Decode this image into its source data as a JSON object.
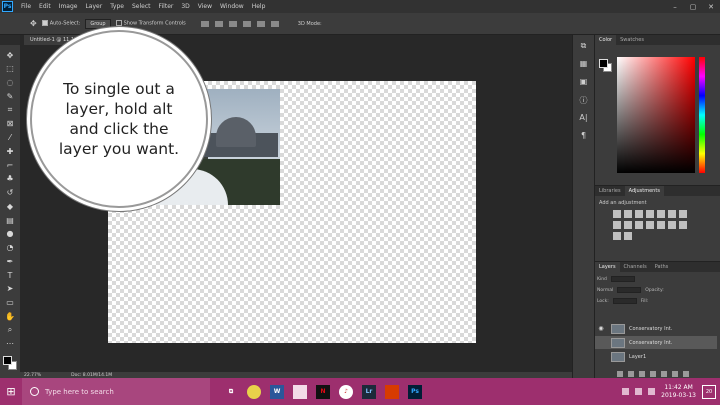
{
  "app": {
    "logo": "Ps",
    "menu": [
      "File",
      "Edit",
      "Image",
      "Layer",
      "Type",
      "Select",
      "Filter",
      "3D",
      "View",
      "Window",
      "Help"
    ],
    "window_controls": [
      "–",
      "▢",
      "✕"
    ]
  },
  "options_bar": {
    "auto_select_label": "Auto-Select:",
    "auto_select_value": "Group",
    "transform_label": "Show Transform Controls",
    "mode_label": "3D Mode:"
  },
  "document": {
    "tab_label": "Untitled-1 @ 11.1% (Conservatory Int..., RGB/8) *"
  },
  "callout": {
    "text": "To single out a layer, hold alt and click the layer you want."
  },
  "status_bar": {
    "zoom": "22.77%",
    "doc_size": "Doc: 8.01M/14.1M"
  },
  "panels": {
    "color_tabs": [
      "Color",
      "Swatches"
    ],
    "adjust_tabs": [
      "Libraries",
      "Adjustments"
    ],
    "adjust_label": "Add an adjustment",
    "layers_tabs": [
      "Layers",
      "Channels",
      "Paths"
    ],
    "layers_kind": "Kind",
    "blend_mode": "Normal",
    "opacity_label": "Opacity:",
    "lock_label": "Lock:",
    "fill_label": "Fill:",
    "layers": [
      {
        "name": "Conservatory Int.",
        "visible": true,
        "selected": false
      },
      {
        "name": "Conservatory Int.",
        "visible": false,
        "selected": true
      },
      {
        "name": "Layer1",
        "visible": false,
        "selected": false
      }
    ]
  },
  "taskbar": {
    "search_placeholder": "Type here to search",
    "apps": [
      "Chrome",
      "Word",
      "Mail",
      "Netflix",
      "iTunes",
      "Lr",
      "Photos",
      "Ps"
    ],
    "time": "11:42 AM",
    "date": "2019-03-13",
    "notifications": "20"
  },
  "colors": {
    "taskbar": "#9d2f6e",
    "workspace": "#282828",
    "panel": "#3c3c3c"
  }
}
